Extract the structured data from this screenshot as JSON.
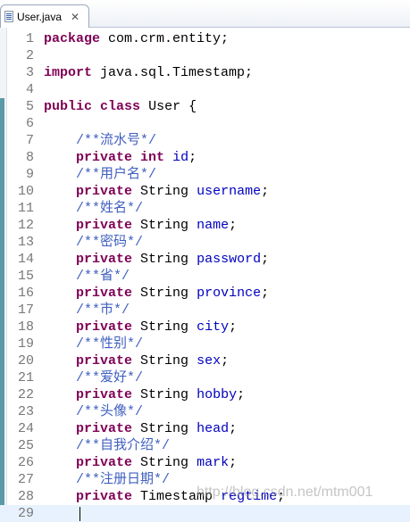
{
  "tab": {
    "title": "User.java",
    "close_icon": "close-icon",
    "file_icon": "java-file-icon"
  },
  "colors": {
    "keyword": "#7f0055",
    "field": "#0000c0",
    "comment": "#3f5fbf",
    "line_number": "#787878",
    "current_line": "#e8f2fe"
  },
  "lines": [
    {
      "n": "1",
      "tokens": [
        [
          "kw",
          "package"
        ],
        [
          "",
          "com.crm.entity;"
        ]
      ]
    },
    {
      "n": "2",
      "tokens": []
    },
    {
      "n": "3",
      "tokens": [
        [
          "kw",
          "import"
        ],
        [
          "",
          "java.sql.Timestamp;"
        ]
      ]
    },
    {
      "n": "4",
      "tokens": []
    },
    {
      "n": "5",
      "tokens": [
        [
          "kw",
          "public"
        ],
        [
          "kw",
          "class"
        ],
        [
          "",
          "User {"
        ]
      ]
    },
    {
      "n": "6",
      "tokens": []
    },
    {
      "n": "7",
      "tokens": [
        [
          "cm",
          "    /**流水号*/"
        ]
      ]
    },
    {
      "n": "8",
      "tokens": [
        [
          "kw",
          "    private"
        ],
        [
          "kw",
          "int"
        ],
        [
          "fd",
          "id"
        ],
        [
          "",
          ";"
        ]
      ]
    },
    {
      "n": "9",
      "tokens": [
        [
          "cm",
          "    /**用户名*/"
        ]
      ]
    },
    {
      "n": "10",
      "tokens": [
        [
          "kw",
          "    private"
        ],
        [
          "",
          "String"
        ],
        [
          "fd",
          "username"
        ],
        [
          "",
          ";"
        ]
      ]
    },
    {
      "n": "11",
      "tokens": [
        [
          "cm",
          "    /**姓名*/"
        ]
      ]
    },
    {
      "n": "12",
      "tokens": [
        [
          "kw",
          "    private"
        ],
        [
          "",
          "String"
        ],
        [
          "fd",
          "name"
        ],
        [
          "",
          ";"
        ]
      ]
    },
    {
      "n": "13",
      "tokens": [
        [
          "cm",
          "    /**密码*/"
        ]
      ]
    },
    {
      "n": "14",
      "tokens": [
        [
          "kw",
          "    private"
        ],
        [
          "",
          "String"
        ],
        [
          "fd",
          "password"
        ],
        [
          "",
          ";"
        ]
      ]
    },
    {
      "n": "15",
      "tokens": [
        [
          "cm",
          "    /**省*/"
        ]
      ]
    },
    {
      "n": "16",
      "tokens": [
        [
          "kw",
          "    private"
        ],
        [
          "",
          "String"
        ],
        [
          "fd",
          "province"
        ],
        [
          "",
          ";"
        ]
      ]
    },
    {
      "n": "17",
      "tokens": [
        [
          "cm",
          "    /**市*/"
        ]
      ]
    },
    {
      "n": "18",
      "tokens": [
        [
          "kw",
          "    private"
        ],
        [
          "",
          "String"
        ],
        [
          "fd",
          "city"
        ],
        [
          "",
          ";"
        ]
      ]
    },
    {
      "n": "19",
      "tokens": [
        [
          "cm",
          "    /**性别*/"
        ]
      ]
    },
    {
      "n": "20",
      "tokens": [
        [
          "kw",
          "    private"
        ],
        [
          "",
          "String"
        ],
        [
          "fd",
          "sex"
        ],
        [
          "",
          ";"
        ]
      ]
    },
    {
      "n": "21",
      "tokens": [
        [
          "cm",
          "    /**爱好*/"
        ]
      ]
    },
    {
      "n": "22",
      "tokens": [
        [
          "kw",
          "    private"
        ],
        [
          "",
          "String"
        ],
        [
          "fd",
          "hobby"
        ],
        [
          "",
          ";"
        ]
      ]
    },
    {
      "n": "23",
      "tokens": [
        [
          "cm",
          "    /**头像*/"
        ]
      ]
    },
    {
      "n": "24",
      "tokens": [
        [
          "kw",
          "    private"
        ],
        [
          "",
          "String"
        ],
        [
          "fd",
          "head"
        ],
        [
          "",
          ";"
        ]
      ]
    },
    {
      "n": "25",
      "tokens": [
        [
          "cm",
          "    /**自我介绍*/"
        ]
      ]
    },
    {
      "n": "26",
      "tokens": [
        [
          "kw",
          "    private"
        ],
        [
          "",
          "String"
        ],
        [
          "fd",
          "mark"
        ],
        [
          "",
          ";"
        ]
      ]
    },
    {
      "n": "27",
      "tokens": [
        [
          "cm",
          "    /**注册日期*/"
        ]
      ]
    },
    {
      "n": "28",
      "tokens": [
        [
          "kw",
          "    private"
        ],
        [
          "",
          "Timestamp"
        ],
        [
          "fd",
          "regtime"
        ],
        [
          "",
          ";"
        ]
      ]
    },
    {
      "n": "29",
      "tokens": []
    }
  ],
  "current_line": "29",
  "watermark": "http://blog.csdn.net/mtm001"
}
